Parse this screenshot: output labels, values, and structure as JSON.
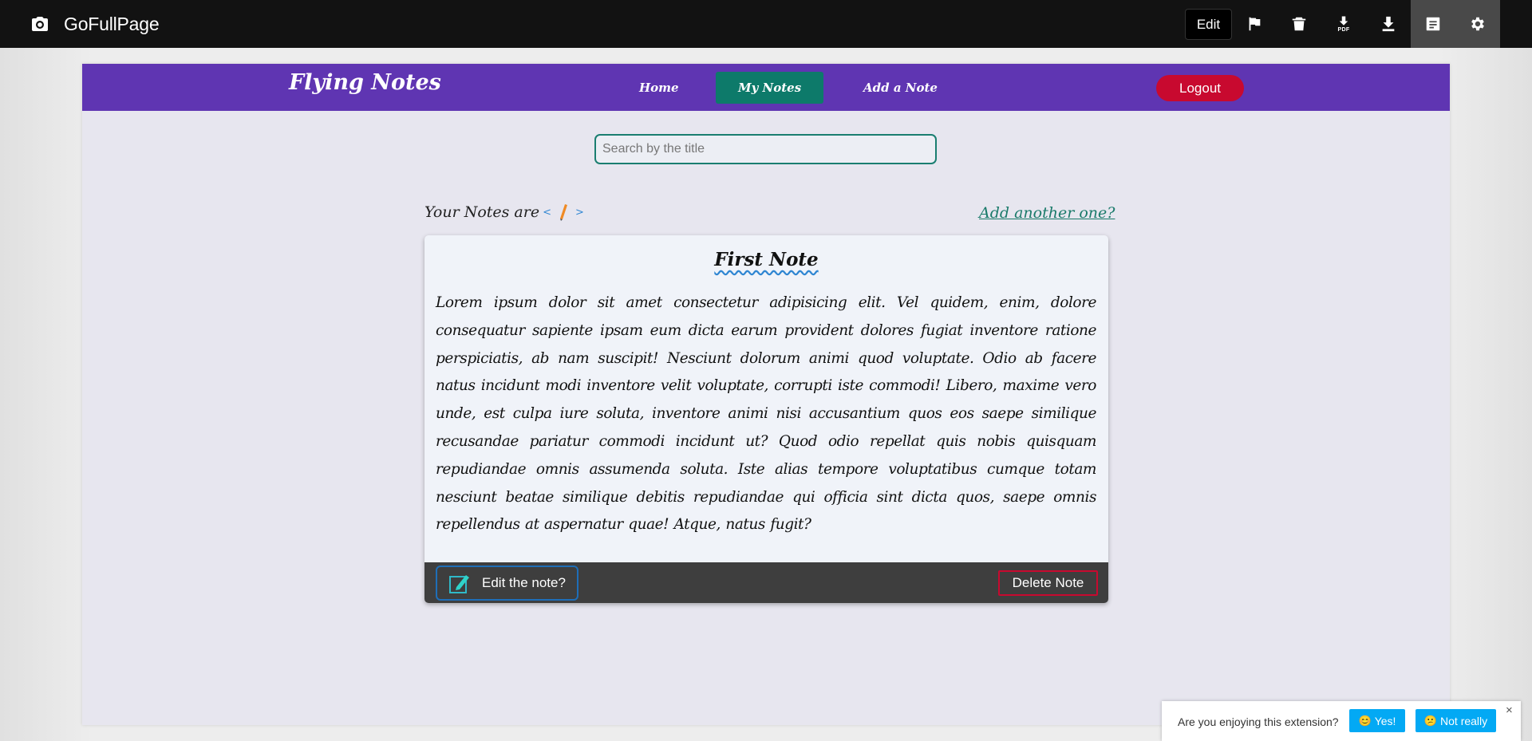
{
  "toolbar": {
    "app_title": "GoFullPage",
    "edit_label": "Edit",
    "pdf_label": "PDF",
    "icons": [
      "camera-icon",
      "flag-icon",
      "trash-icon",
      "download-pdf-icon",
      "download-icon",
      "notes-icon",
      "gear-icon"
    ]
  },
  "site": {
    "brand": "Flying Notes",
    "nav": {
      "home": "Home",
      "my_notes": "My Notes",
      "add_note": "Add a Note"
    },
    "logout_label": "Logout",
    "colors": {
      "nav_bg": "#5f35b2",
      "active_nav": "#0d7a6a",
      "logout": "#c8092f"
    }
  },
  "search": {
    "placeholder": "Search by the title",
    "value": ""
  },
  "notes_section": {
    "heading": "Your Notes are",
    "add_another": "Add another one?"
  },
  "note": {
    "title": "First Note",
    "body": "Lorem ipsum dolor sit amet consectetur adipisicing elit. Vel quidem, enim, dolore consequatur sapiente ipsam eum dicta earum provident dolores fugiat inventore ratione perspiciatis, ab nam suscipit! Nesciunt dolorum animi quod voluptate. Odio ab facere natus incidunt modi inventore velit voluptate, corrupti iste commodi! Libero, maxime vero unde, est culpa iure soluta, inventore animi nisi accusantium quos eos saepe similique recusandae pariatur commodi incidunt ut? Quod odio repellat quis nobis quisquam repudiandae omnis assumenda soluta. Iste alias tempore voluptatibus cumque totam nesciunt beatae similique debitis repudiandae qui officia sint dicta quos, saepe omnis repellendus at aspernatur quae! Atque, natus fugit?",
    "edit_label": "Edit the note?",
    "delete_label": "Delete Note"
  },
  "feedback": {
    "question": "Are you enjoying this extension?",
    "yes": "Yes!",
    "no": "Not really",
    "close": "×"
  }
}
